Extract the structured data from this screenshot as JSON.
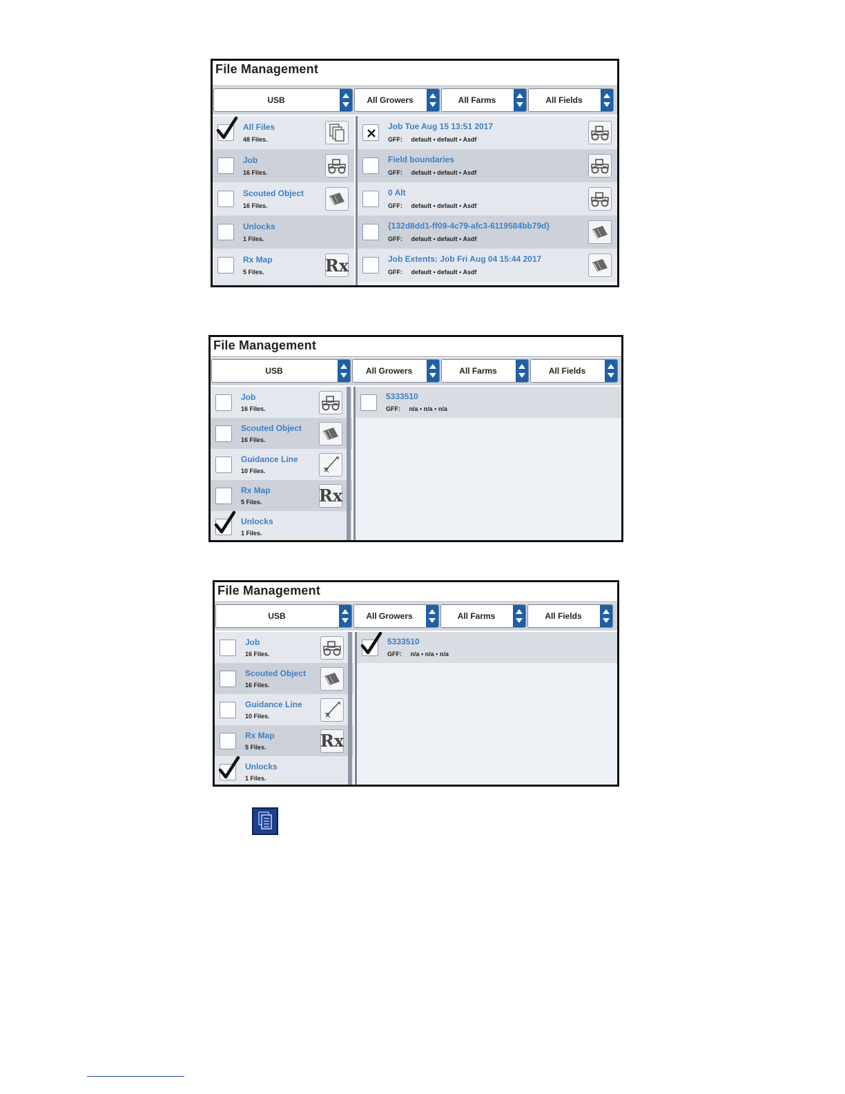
{
  "screens": [
    {
      "title": "File Management",
      "dropdowns": [
        "USB",
        "All Growers",
        "All Farms",
        "All Fields"
      ],
      "left_items": [
        {
          "name": "All Files",
          "count": "48 Files.",
          "checked": true,
          "icon": "files-icon"
        },
        {
          "name": "Job",
          "count": "16 Files.",
          "checked": false,
          "icon": "tractor-icon"
        },
        {
          "name": "Scouted Object",
          "count": "16 Files.",
          "checked": false,
          "icon": "flag-icon"
        },
        {
          "name": "Unlocks",
          "count": "1 Files.",
          "checked": false,
          "icon": ""
        },
        {
          "name": "Rx Map",
          "count": "5 Files.",
          "checked": false,
          "icon": "rx-icon"
        }
      ],
      "right_items": [
        {
          "name": "Job Tue Aug 15 13:51 2017",
          "gff": "GFF:",
          "values": "default • default • Asdf",
          "mark": "x",
          "icon": "tractor-icon"
        },
        {
          "name": "Field boundaries",
          "gff": "GFF:",
          "values": "default • default • Asdf",
          "mark": "",
          "icon": "tractor-icon"
        },
        {
          "name": "0 Alt",
          "gff": "GFF:",
          "values": "default • default • Asdf",
          "mark": "",
          "icon": "tractor-icon"
        },
        {
          "name": "{132d8dd1-ff09-4c79-afc3-6119584bb79d}",
          "gff": "GFF:",
          "values": "default • default • Asdf",
          "mark": "",
          "icon": "flag-icon"
        },
        {
          "name": "Job Extents: Job Fri Aug 04 15:44 2017",
          "gff": "GFF:",
          "values": "default • default • Asdf",
          "mark": "",
          "icon": "flag-icon"
        }
      ]
    },
    {
      "title": "File Management",
      "dropdowns": [
        "USB",
        "All Growers",
        "All Farms",
        "All Fields"
      ],
      "left_items": [
        {
          "name": "Job",
          "count": "16 Files.",
          "checked": false,
          "icon": "tractor-icon"
        },
        {
          "name": "Scouted Object",
          "count": "16 Files.",
          "checked": false,
          "icon": "flag-icon"
        },
        {
          "name": "Guidance Line",
          "count": "10 Files.",
          "checked": false,
          "icon": "guidance-icon"
        },
        {
          "name": "Rx Map",
          "count": "5 Files.",
          "checked": false,
          "icon": "rx-icon"
        },
        {
          "name": "Unlocks",
          "count": "1 Files.",
          "checked": true,
          "icon": ""
        }
      ],
      "right_items": [
        {
          "name": "5333510",
          "gff": "GFF:",
          "values": "n/a • n/a • n/a",
          "mark": "",
          "icon": ""
        }
      ]
    },
    {
      "title": "File Management",
      "dropdowns": [
        "USB",
        "All Growers",
        "All Farms",
        "All Fields"
      ],
      "left_items": [
        {
          "name": "Job",
          "count": "16 Files.",
          "checked": false,
          "icon": "tractor-icon"
        },
        {
          "name": "Scouted Object",
          "count": "16 Files.",
          "checked": false,
          "icon": "flag-icon"
        },
        {
          "name": "Guidance Line",
          "count": "10 Files.",
          "checked": false,
          "icon": "guidance-icon"
        },
        {
          "name": "Rx Map",
          "count": "5 Files.",
          "checked": false,
          "icon": "rx-icon"
        },
        {
          "name": "Unlocks",
          "count": "1 Files.",
          "checked": true,
          "icon": ""
        }
      ],
      "right_items": [
        {
          "name": "5333510",
          "gff": "GFF:",
          "values": "n/a • n/a • n/a",
          "mark": "check",
          "icon": ""
        }
      ]
    }
  ],
  "footer_icon": "copy-files-icon",
  "rx_symbol": "Rx"
}
